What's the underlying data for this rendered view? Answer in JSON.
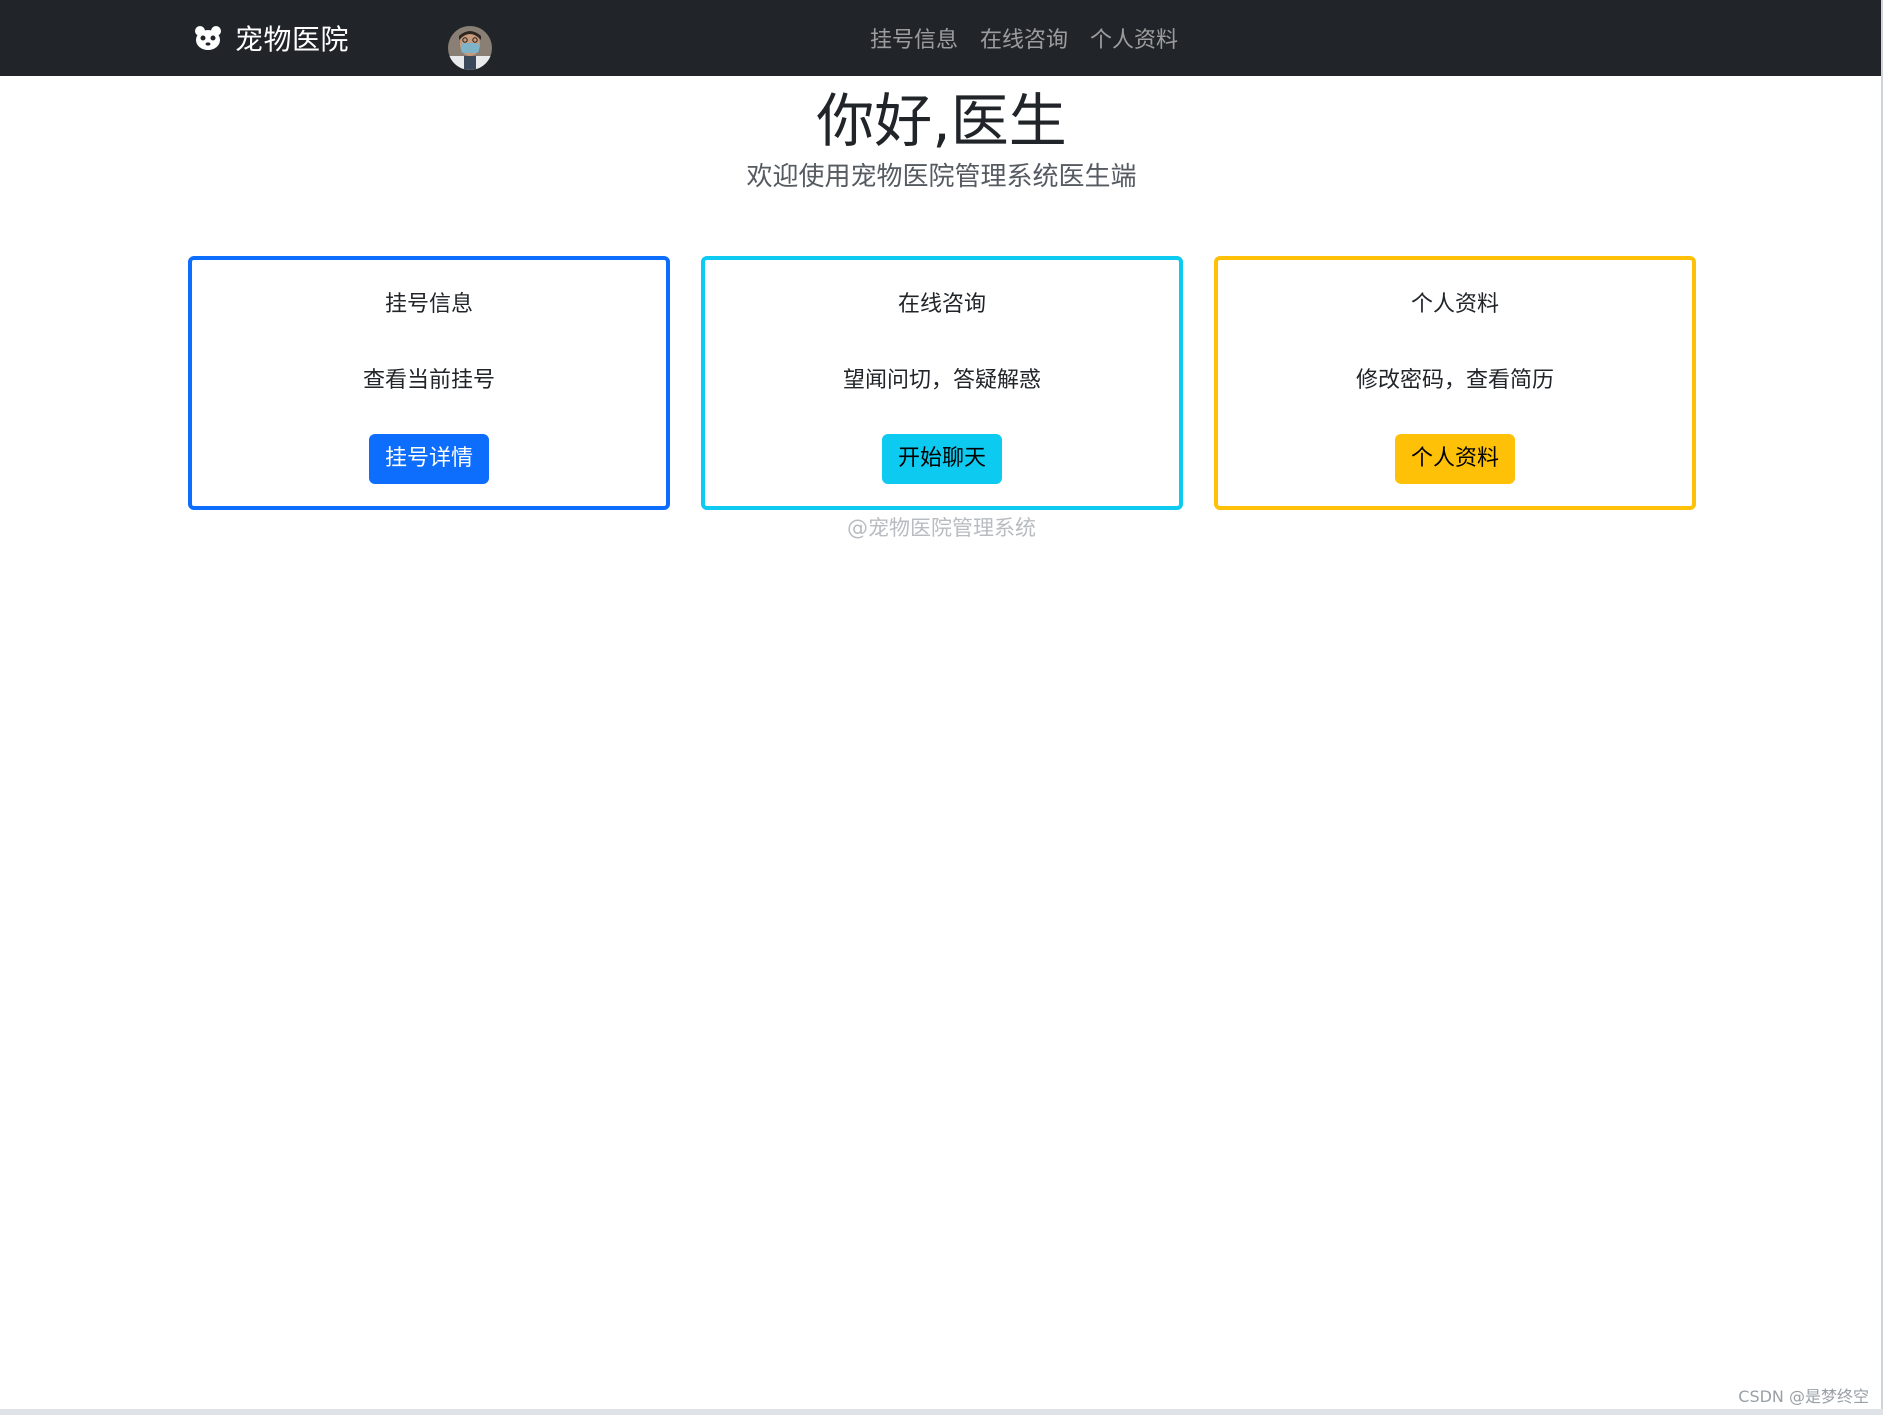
{
  "navbar": {
    "brand": "宠物医院",
    "brand_icon": "paw-face-icon",
    "avatar_icon": "doctor-avatar",
    "links": [
      {
        "label": "挂号信息"
      },
      {
        "label": "在线咨询"
      },
      {
        "label": "个人资料"
      }
    ]
  },
  "hero": {
    "title": "你好,医生",
    "subtitle": "欢迎使用宠物医院管理系统医生端"
  },
  "cards": [
    {
      "title": "挂号信息",
      "text": "查看当前挂号",
      "button": "挂号详情",
      "color": "#0d6efd"
    },
    {
      "title": "在线咨询",
      "text": "望闻问切，答疑解惑",
      "button": "开始聊天",
      "color": "#0dcaf0"
    },
    {
      "title": "个人资料",
      "text": "修改密码，查看简历",
      "button": "个人资料",
      "color": "#ffc107"
    }
  ],
  "footer": {
    "note": "@宠物医院管理系统"
  },
  "watermark": "CSDN @是梦终空"
}
